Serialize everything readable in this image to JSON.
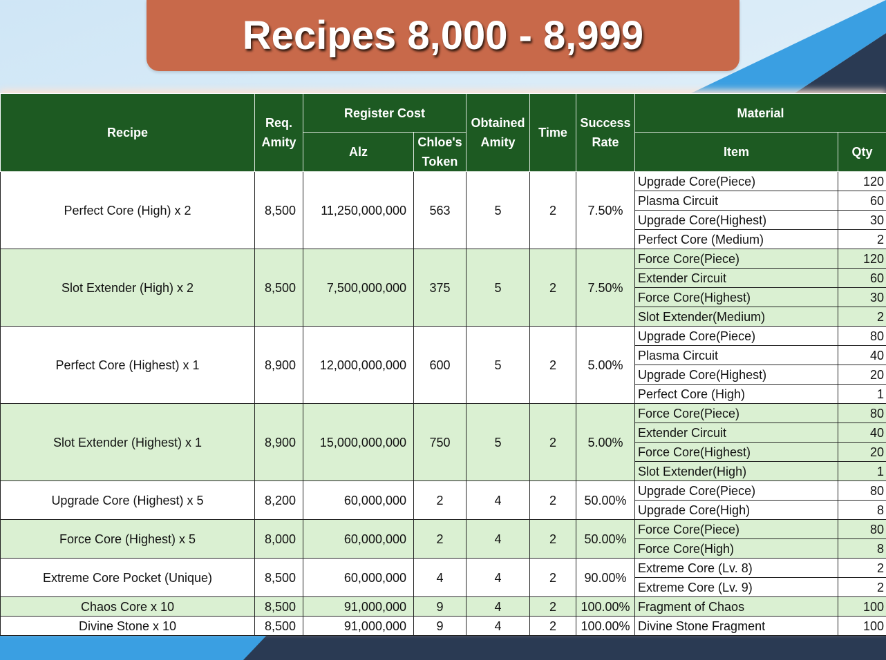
{
  "title": "Recipes 8,000 - 8,999",
  "colors": {
    "title_banner": "#c8694a",
    "header_green": "#1d5a22",
    "band_green": "#daf0d2",
    "row_white": "#ffffff",
    "accent_blue": "#3a9fe2",
    "accent_navy": "#2a3a53"
  },
  "headers": {
    "recipe": "Recipe",
    "req_amity": "Req. Amity",
    "register_cost": "Register Cost",
    "alz": "Alz",
    "chloes_token": "Chloe's Token",
    "obtained_amity": "Obtained Amity",
    "time": "Time",
    "success_rate": "Success Rate",
    "material": "Material",
    "item": "Item",
    "qty": "Qty"
  },
  "rows": [
    {
      "recipe": "Perfect Core (High) x 2",
      "req_amity": "8,500",
      "alz": "11,250,000,000",
      "chloes_token": "563",
      "obtained_amity": "5",
      "time": "2",
      "success_rate": "7.50%",
      "materials": [
        {
          "item": "Upgrade Core(Piece)",
          "qty": "120"
        },
        {
          "item": "Plasma Circuit",
          "qty": "60"
        },
        {
          "item": "Upgrade Core(Highest)",
          "qty": "30"
        },
        {
          "item": "Perfect Core (Medium)",
          "qty": "2"
        }
      ]
    },
    {
      "recipe": "Slot Extender (High) x 2",
      "req_amity": "8,500",
      "alz": "7,500,000,000",
      "chloes_token": "375",
      "obtained_amity": "5",
      "time": "2",
      "success_rate": "7.50%",
      "materials": [
        {
          "item": "Force Core(Piece)",
          "qty": "120"
        },
        {
          "item": "Extender Circuit",
          "qty": "60"
        },
        {
          "item": "Force Core(Highest)",
          "qty": "30"
        },
        {
          "item": "Slot Extender(Medium)",
          "qty": "2"
        }
      ]
    },
    {
      "recipe": "Perfect Core (Highest) x 1",
      "req_amity": "8,900",
      "alz": "12,000,000,000",
      "chloes_token": "600",
      "obtained_amity": "5",
      "time": "2",
      "success_rate": "5.00%",
      "materials": [
        {
          "item": "Upgrade Core(Piece)",
          "qty": "80"
        },
        {
          "item": "Plasma Circuit",
          "qty": "40"
        },
        {
          "item": "Upgrade Core(Highest)",
          "qty": "20"
        },
        {
          "item": "Perfect Core (High)",
          "qty": "1"
        }
      ]
    },
    {
      "recipe": "Slot Extender (Highest) x 1",
      "req_amity": "8,900",
      "alz": "15,000,000,000",
      "chloes_token": "750",
      "obtained_amity": "5",
      "time": "2",
      "success_rate": "5.00%",
      "materials": [
        {
          "item": "Force Core(Piece)",
          "qty": "80"
        },
        {
          "item": "Extender Circuit",
          "qty": "40"
        },
        {
          "item": "Force Core(Highest)",
          "qty": "20"
        },
        {
          "item": "Slot Extender(High)",
          "qty": "1"
        }
      ]
    },
    {
      "recipe": "Upgrade Core (Highest) x 5",
      "req_amity": "8,200",
      "alz": "60,000,000",
      "chloes_token": "2",
      "obtained_amity": "4",
      "time": "2",
      "success_rate": "50.00%",
      "materials": [
        {
          "item": "Upgrade Core(Piece)",
          "qty": "80"
        },
        {
          "item": "Upgrade Core(High)",
          "qty": "8"
        }
      ]
    },
    {
      "recipe": "Force Core (Highest) x 5",
      "req_amity": "8,000",
      "alz": "60,000,000",
      "chloes_token": "2",
      "obtained_amity": "4",
      "time": "2",
      "success_rate": "50.00%",
      "materials": [
        {
          "item": "Force Core(Piece)",
          "qty": "80"
        },
        {
          "item": "Force Core(High)",
          "qty": "8"
        }
      ]
    },
    {
      "recipe": "Extreme Core Pocket (Unique)",
      "req_amity": "8,500",
      "alz": "60,000,000",
      "chloes_token": "4",
      "obtained_amity": "4",
      "time": "2",
      "success_rate": "90.00%",
      "materials": [
        {
          "item": "Extreme Core (Lv. 8)",
          "qty": "2"
        },
        {
          "item": "Extreme Core (Lv. 9)",
          "qty": "2"
        }
      ]
    },
    {
      "recipe": "Chaos Core x 10",
      "req_amity": "8,500",
      "alz": "91,000,000",
      "chloes_token": "9",
      "obtained_amity": "4",
      "time": "2",
      "success_rate": "100.00%",
      "materials": [
        {
          "item": "Fragment of Chaos",
          "qty": "100"
        }
      ]
    },
    {
      "recipe": "Divine Stone x 10",
      "req_amity": "8,500",
      "alz": "91,000,000",
      "chloes_token": "9",
      "obtained_amity": "4",
      "time": "2",
      "success_rate": "100.00%",
      "materials": [
        {
          "item": "Divine Stone Fragment",
          "qty": "100"
        }
      ]
    }
  ]
}
